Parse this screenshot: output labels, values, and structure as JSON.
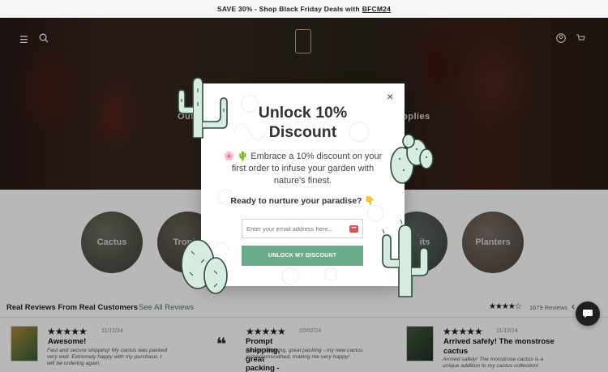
{
  "announcement": {
    "text_prefix": "SAVE 30% - Shop Black Friday Deals with",
    "code": "BFCM24"
  },
  "hero": {
    "text_left": "Out",
    "text_right": "pplies"
  },
  "categories": [
    {
      "label": "Cactus"
    },
    {
      "label": "Tropi"
    },
    {
      "label": "its"
    },
    {
      "label": "Planters"
    }
  ],
  "reviews_section": {
    "title": "Real Reviews From Real Customers",
    "see_all": "See All Reviews",
    "rating_stars": "★★★★☆",
    "count": "1679 Reviews"
  },
  "reviews": [
    {
      "stars": "★★★★★",
      "date": "11/12/24",
      "headline": "Awesome!",
      "body": "Fast and secure shipping! My cactus was packed very well. Extremely happy with my purchase. I will be ordering again."
    },
    {
      "stars": "★★★★★",
      "date": "10/02/24",
      "headline": "Prompt shipping, great packing -",
      "body": "Prompt shipping, great packing - my new cactus arrived unscathed, making me very happy!"
    },
    {
      "stars": "★★★★★",
      "date": "11/12/24",
      "headline": "Arrived safely! The monstrose cactus",
      "body": "Arrived safely! The monstrose cactus is a unique addition to my cactus collection!"
    }
  ],
  "popup": {
    "title_line1": "Unlock 10%",
    "title_line2": "Discount",
    "body_emoji": "🌸 🌵",
    "body": "Embrace a 10% discount on your first order to infuse your garden with nature's finest.",
    "question": "Ready to nurture your paradise? 👇",
    "email_placeholder": "Enter your email address here...",
    "button_label": "UNLOCK MY DISCOUNT",
    "close_glyph": "×"
  },
  "colors": {
    "accent": "#6aab8b",
    "link": "#3e7d5d",
    "cactus": "#d6ece0"
  }
}
